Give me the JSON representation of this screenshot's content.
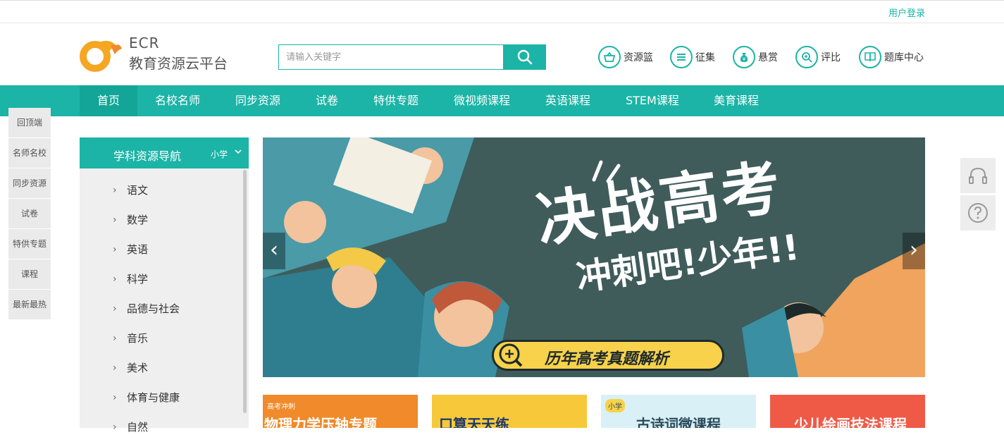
{
  "topbar": {
    "login": "用户登录"
  },
  "header": {
    "logo_abbr": "ECR",
    "logo_name": "教育资源云平台",
    "search_placeholder": "请输入关键字",
    "quick_links": [
      {
        "label": "资源篮",
        "icon": "basket-icon"
      },
      {
        "label": "征集",
        "icon": "list-icon"
      },
      {
        "label": "悬赏",
        "icon": "money-bag-icon"
      },
      {
        "label": "评比",
        "icon": "compare-icon"
      },
      {
        "label": "题库中心",
        "icon": "book-icon"
      }
    ]
  },
  "nav": {
    "items": [
      "首页",
      "名校名师",
      "同步资源",
      "试卷",
      "特供专题",
      "微视频课程",
      "英语课程",
      "STEM课程",
      "美育课程"
    ],
    "active": "首页"
  },
  "float_left": [
    "回顶端",
    "名师名校",
    "同步资源",
    "试卷",
    "特供专题",
    "课程",
    "最新最热"
  ],
  "subject_nav": {
    "title": "学科资源导航",
    "level": "小学",
    "subjects": [
      "语文",
      "数学",
      "英语",
      "科学",
      "品德与社会",
      "音乐",
      "美术",
      "体育与健康",
      "自然"
    ]
  },
  "banner": {
    "headline": "决战高考",
    "subline": "冲刺吧!少年!!",
    "tagline": "历年高考真题解析",
    "prev": "‹",
    "next": "›"
  },
  "float_right": [
    "headset-icon",
    "question-icon"
  ],
  "cards": [
    {
      "tag": "高考冲刺",
      "title": "物理力学压轴专题",
      "bg": "#f08a2a",
      "fg": "#ffffff"
    },
    {
      "tag": "",
      "title": "口算天天练",
      "bg": "#f6c83a",
      "fg": "#1e3a6a"
    },
    {
      "tag": "小学",
      "title": "古诗词微课程",
      "bg": "#d9f0f6",
      "fg": "#2a4a5a"
    },
    {
      "tag": "",
      "title": "少儿绘画技法课程",
      "bg": "#ef5a47",
      "fg": "#ffffff"
    }
  ],
  "colors": {
    "accent": "#1bb4a6",
    "logo_orange": "#f5a623"
  }
}
